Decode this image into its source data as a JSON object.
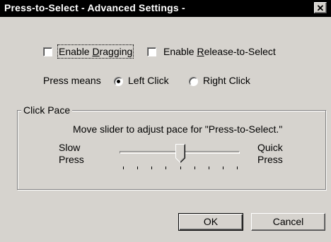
{
  "window": {
    "title": "Press-to-Select - Advanced Settings -",
    "close_glyph": "✕"
  },
  "options": {
    "enable_dragging": {
      "prefix": "Enable ",
      "accel": "D",
      "suffix": "ragging",
      "checked": false
    },
    "enable_release": {
      "prefix": "Enable ",
      "accel": "R",
      "suffix": "elease-to-Select",
      "checked": false
    }
  },
  "press_means": {
    "label": "Press means",
    "choices": [
      {
        "label": "Left Click",
        "selected": true
      },
      {
        "label": "Right Click",
        "selected": false
      }
    ]
  },
  "click_pace": {
    "legend": "Click Pace",
    "instruction": "Move slider to adjust pace for \"Press-to-Select.\"",
    "slow_line1": "Slow",
    "slow_line2": "Press",
    "quick_line1": "Quick",
    "quick_line2": "Press",
    "slider_value": 4,
    "tick_count": 9
  },
  "buttons": {
    "ok": "OK",
    "cancel": "Cancel"
  }
}
